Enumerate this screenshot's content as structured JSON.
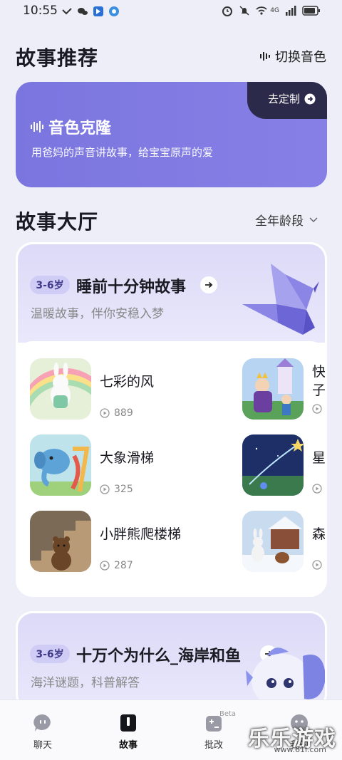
{
  "status_bar": {
    "time": "10:55",
    "network_label": "4G"
  },
  "header": {
    "title": "故事推荐",
    "switch_voice_label": "切换音色"
  },
  "clone_banner": {
    "title": "音色克隆",
    "subtitle": "用爸妈的声音讲故事，给宝宝原声的爱",
    "customize_label": "去定制",
    "colors": {
      "background": "#7e78e2",
      "tab": "#2c2a4a"
    }
  },
  "hall": {
    "title": "故事大厅",
    "age_filter_label": "全年龄段"
  },
  "collections": [
    {
      "age_badge": "3-6岁",
      "title": "睡前十分钟故事",
      "subtitle": "温暖故事，伴你安稳入梦",
      "stories": [
        {
          "title": "七彩的风",
          "plays": "889",
          "thumb_icon": "rabbit-rainbow-icon"
        },
        {
          "title": "快子",
          "plays": "",
          "thumb_icon": "king-castle-icon"
        },
        {
          "title": "大象滑梯",
          "plays": "325",
          "thumb_icon": "elephant-slide-icon"
        },
        {
          "title": "星",
          "plays": "",
          "thumb_icon": "shooting-star-icon"
        },
        {
          "title": "小胖熊爬楼梯",
          "plays": "287",
          "thumb_icon": "bear-stairs-icon"
        },
        {
          "title": "森",
          "plays": "",
          "thumb_icon": "snow-cabin-icon"
        }
      ]
    },
    {
      "age_badge": "3-6岁",
      "title": "十万个为什么_海岸和鱼",
      "subtitle": "海洋谜题，科普解答"
    }
  ],
  "bottom_nav": {
    "items": [
      {
        "label": "聊天",
        "icon": "chat-icon"
      },
      {
        "label": "故事",
        "icon": "book-icon",
        "active": true
      },
      {
        "label": "批改",
        "icon": "correct-icon",
        "badge": "Beta"
      },
      {
        "label": "我的",
        "icon": "profile-icon"
      }
    ]
  },
  "watermark": {
    "text": "乐乐游戏",
    "url": "www.61l.com"
  }
}
